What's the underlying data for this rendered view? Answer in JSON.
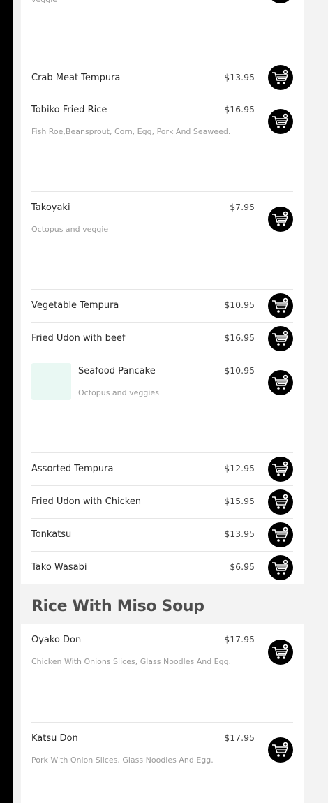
{
  "colors": {
    "accent": "#000000",
    "thumb_bg": "#e9f8f3"
  },
  "appetizers": {
    "top_desc": "veggie",
    "items": [
      {
        "name": "Crab Meat Tempura",
        "price": "$13.95",
        "desc": ""
      },
      {
        "name": "Tobiko Fried Rice",
        "price": "$16.95",
        "desc": "Fish Roe,Beansprout, Corn, Egg, Pork And Seaweed."
      },
      {
        "name": "Takoyaki",
        "price": "$7.95",
        "desc": "Octopus and veggie"
      },
      {
        "name": "Vegetable Tempura",
        "price": "$10.95",
        "desc": ""
      },
      {
        "name": "Fried Udon with beef",
        "price": "$16.95",
        "desc": ""
      },
      {
        "name": "Seafood Pancake",
        "price": "$10.95",
        "desc": "Octopus and veggies"
      },
      {
        "name": "Assorted Tempura",
        "price": "$12.95",
        "desc": ""
      },
      {
        "name": "Fried Udon with Chicken",
        "price": "$15.95",
        "desc": ""
      },
      {
        "name": "Tonkatsu",
        "price": "$13.95",
        "desc": ""
      },
      {
        "name": "Tako Wasabi",
        "price": "$6.95",
        "desc": ""
      }
    ]
  },
  "rice": {
    "title": "Rice With Miso Soup",
    "items": [
      {
        "name": "Oyako Don",
        "price": "$17.95",
        "desc": "Chicken With Onions Slices, Glass Noodles And Egg."
      },
      {
        "name": "Katsu Don",
        "price": "$17.95",
        "desc": "Pork With Onion Slices, Glass Noodles And Egg."
      }
    ]
  },
  "icons": {
    "cart": "add-to-cart-icon"
  }
}
